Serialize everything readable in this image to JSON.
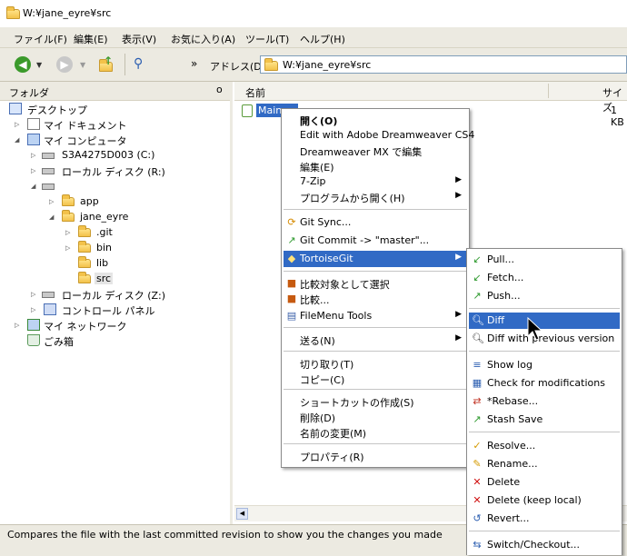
{
  "window": {
    "title": "W:¥jane_eyre¥src"
  },
  "menubar": [
    "ファイル(F)",
    "編集(E)",
    "表示(V)",
    "お気に入り(A)",
    "ツール(T)",
    "ヘルプ(H)"
  ],
  "toolbar": {
    "more": "»",
    "address_label": "アドレス(D)",
    "address_value": "W:¥jane_eyre¥src"
  },
  "folders_pane": {
    "title": "フォルダ",
    "close": "o",
    "tree": [
      "デスクトップ",
      "マイ ドキュメント",
      "マイ コンピュータ",
      "S3A4275D003 (C:)",
      "ローカル ディスク (R:)",
      "app",
      "jane_eyre",
      ".git",
      "bin",
      "lib",
      "src",
      "ローカル ディスク (Z:)",
      "コントロール パネル",
      "マイ ネットワーク",
      "ごみ箱"
    ]
  },
  "file_list": {
    "col_name": "名前",
    "col_size": "サイズ",
    "file_name": "Main.as",
    "file_size": "1 KB"
  },
  "context_menu": [
    "開く(O)",
    "Edit with Adobe Dreamweaver CS4",
    "Dreamweaver MX で編集",
    "編集(E)",
    "7-Zip",
    "プログラムから開く(H)",
    "Git Sync...",
    "Git Commit -> \"master\"...",
    "TortoiseGit",
    "比較対象として選択",
    "比較...",
    "FileMenu Tools",
    "送る(N)",
    "切り取り(T)",
    "コピー(C)",
    "ショートカットの作成(S)",
    "削除(D)",
    "名前の変更(M)",
    "プロパティ(R)"
  ],
  "tortoise_submenu": [
    "Pull...",
    "Fetch...",
    "Push...",
    "Diff",
    "Diff with previous version",
    "Show log",
    "Check for modifications",
    "*Rebase...",
    "Stash Save",
    "Resolve...",
    "Rename...",
    "Delete",
    "Delete (keep local)",
    "Revert...",
    "Switch/Checkout..."
  ],
  "status_text": "Compares the file with the last committed revision to show you the changes you made",
  "colors": {
    "highlight": "#316ac5",
    "chrome": "#eceae1"
  }
}
